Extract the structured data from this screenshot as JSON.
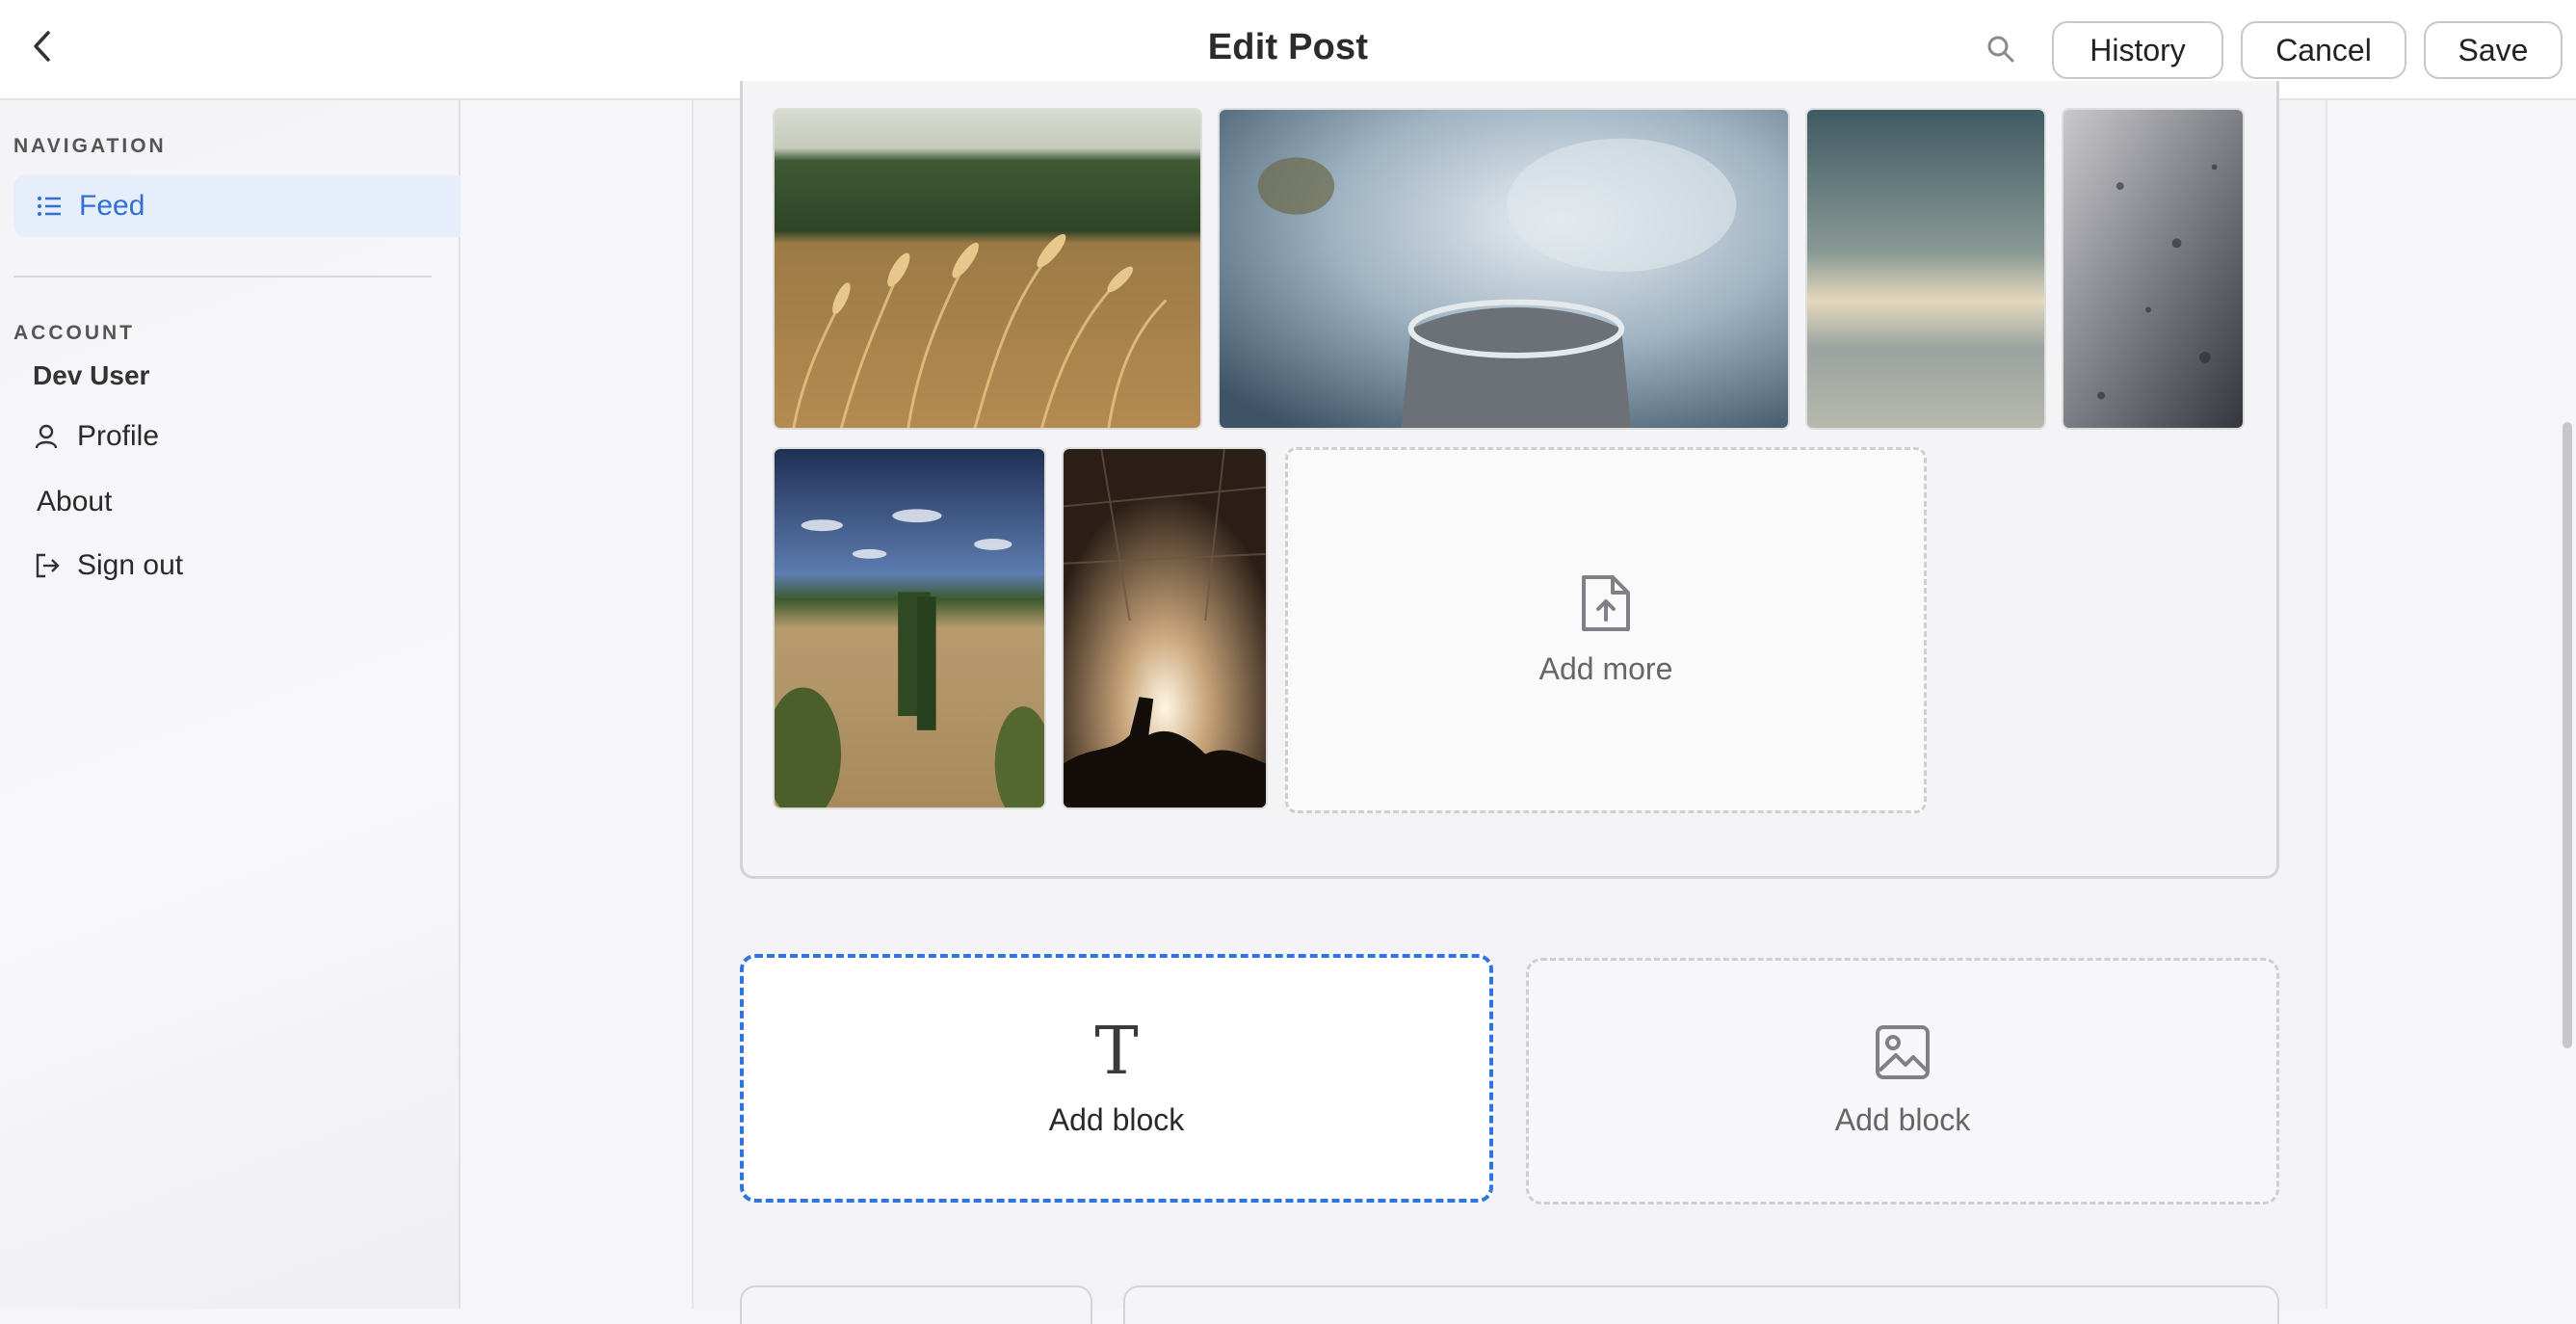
{
  "header": {
    "title": "Edit Post",
    "back_icon": "chevron-left-icon",
    "search_icon": "search-icon",
    "history_label": "History",
    "cancel_label": "Cancel",
    "save_label": "Save"
  },
  "sidebar": {
    "navigation_label": "NAVIGATION",
    "nav_items": [
      {
        "label": "Feed",
        "icon": "list-icon",
        "active": true
      }
    ],
    "account_label": "ACCOUNT",
    "account_name": "Dev User",
    "account_items": [
      {
        "label": "Profile",
        "icon": "person-icon"
      },
      {
        "label": "About",
        "icon": ""
      },
      {
        "label": "Sign out",
        "icon": "sign-out-icon"
      }
    ]
  },
  "gallery": {
    "photos": [
      {
        "subject": "wheat field"
      },
      {
        "subject": "steaming cup"
      },
      {
        "subject": "cloudy sky"
      },
      {
        "subject": "textured surface"
      },
      {
        "subject": "tuscany landscape"
      },
      {
        "subject": "concert crowd"
      }
    ],
    "add_more_label": "Add more",
    "add_more_icon": "file-upload-icon"
  },
  "blocks": {
    "text_block": {
      "label": "Add block",
      "icon": "text-type-icon",
      "glyph": "T"
    },
    "image_block": {
      "label": "Add block",
      "icon": "image-icon"
    }
  },
  "colors": {
    "accent": "#2f74e0",
    "active_nav_bg": "#e6eefb",
    "active_nav_text": "#2f6fd6"
  }
}
